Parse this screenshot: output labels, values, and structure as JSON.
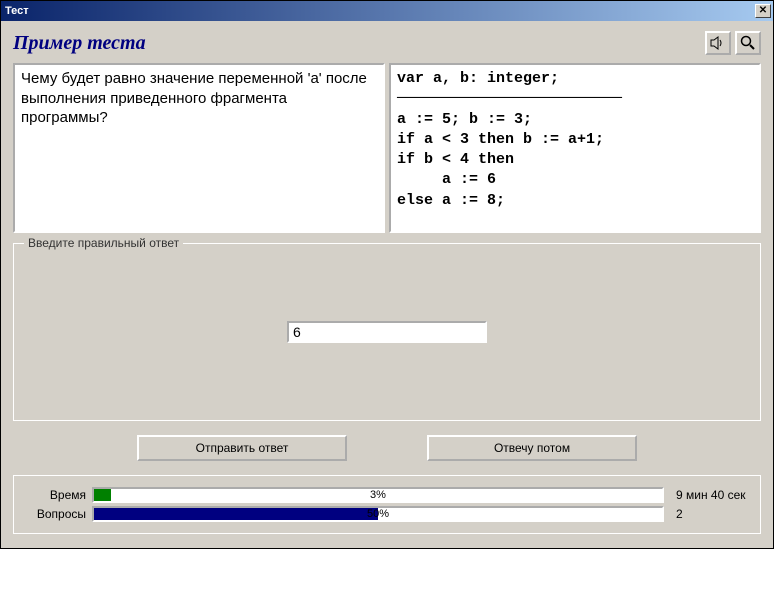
{
  "window": {
    "title": "Тест"
  },
  "heading": "Пример теста",
  "question": "Чему будет равно значение переменной 'a' после выполнения приведенного фрагмента программы?",
  "code": "var a, b: integer;\n─────────────────────────\na := 5; b := 3;\nif a < 3 then b := a+1;\nif b < 4 then\n     a := 6\nelse a := 8;",
  "answer_group_label": "Введите правильный ответ",
  "answer_value": "6",
  "buttons": {
    "submit": "Отправить ответ",
    "later": "Отвечу потом"
  },
  "progress": {
    "time_label": "Время",
    "time_pct": "3%",
    "time_pct_num": 3,
    "time_text": "9 мин 40 сек",
    "questions_label": "Вопросы",
    "questions_pct": "50%",
    "questions_pct_num": 50,
    "questions_text": "2"
  }
}
